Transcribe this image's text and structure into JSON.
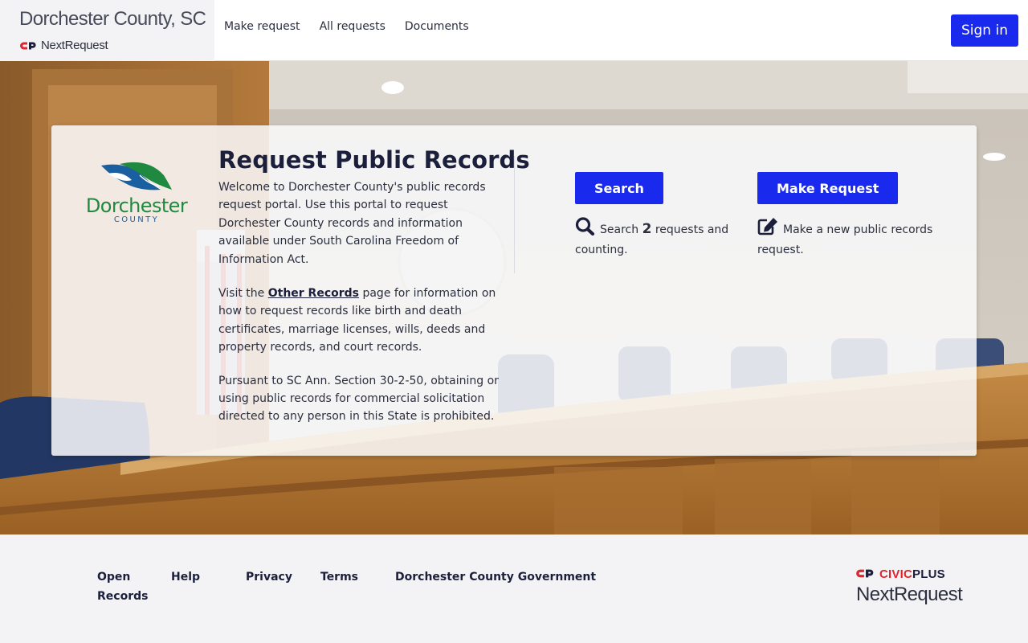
{
  "header": {
    "org_name": "Dorchester County, SC",
    "product": "NextRequest",
    "nav": [
      "Make request",
      "All requests",
      "Documents"
    ],
    "signin_label": "Sign in"
  },
  "hero": {
    "logo": {
      "line1": "Dorchester",
      "line2": "COUNTY"
    },
    "title": "Request Public Records",
    "para1": "Welcome to Dorchester County's public records request portal. Use this portal to request Dorchester County records and information available under South Carolina Freedom of Information Act.",
    "para2_prefix": "Visit the ",
    "para2_link": "Other Records",
    "para2_suffix": " page for information on how to request records like birth and death certificates, marriage licenses, wills, deeds and property records, and court records.",
    "para3": "Pursuant to SC Ann. Section 30-2-50, obtaining or using public records for commercial solicitation directed to any person in this State is prohibited.",
    "search": {
      "button": "Search",
      "desc_prefix": "Search ",
      "count": "2",
      "desc_suffix": " requests and counting."
    },
    "make": {
      "button": "Make Request",
      "desc": "Make a new public records request."
    }
  },
  "footer": {
    "links": [
      "Open Records",
      "Help",
      "Privacy",
      "Terms",
      "Dorchester County Government"
    ],
    "civic_1": "CIVIC",
    "civic_2": "PLUS",
    "product": "NextRequest"
  },
  "colors": {
    "primary": "#1a29ee",
    "brand_red": "#e0262f",
    "heading": "#1b1f3b",
    "logo_green": "#1f8a3f",
    "logo_blue": "#1a5fa0"
  }
}
